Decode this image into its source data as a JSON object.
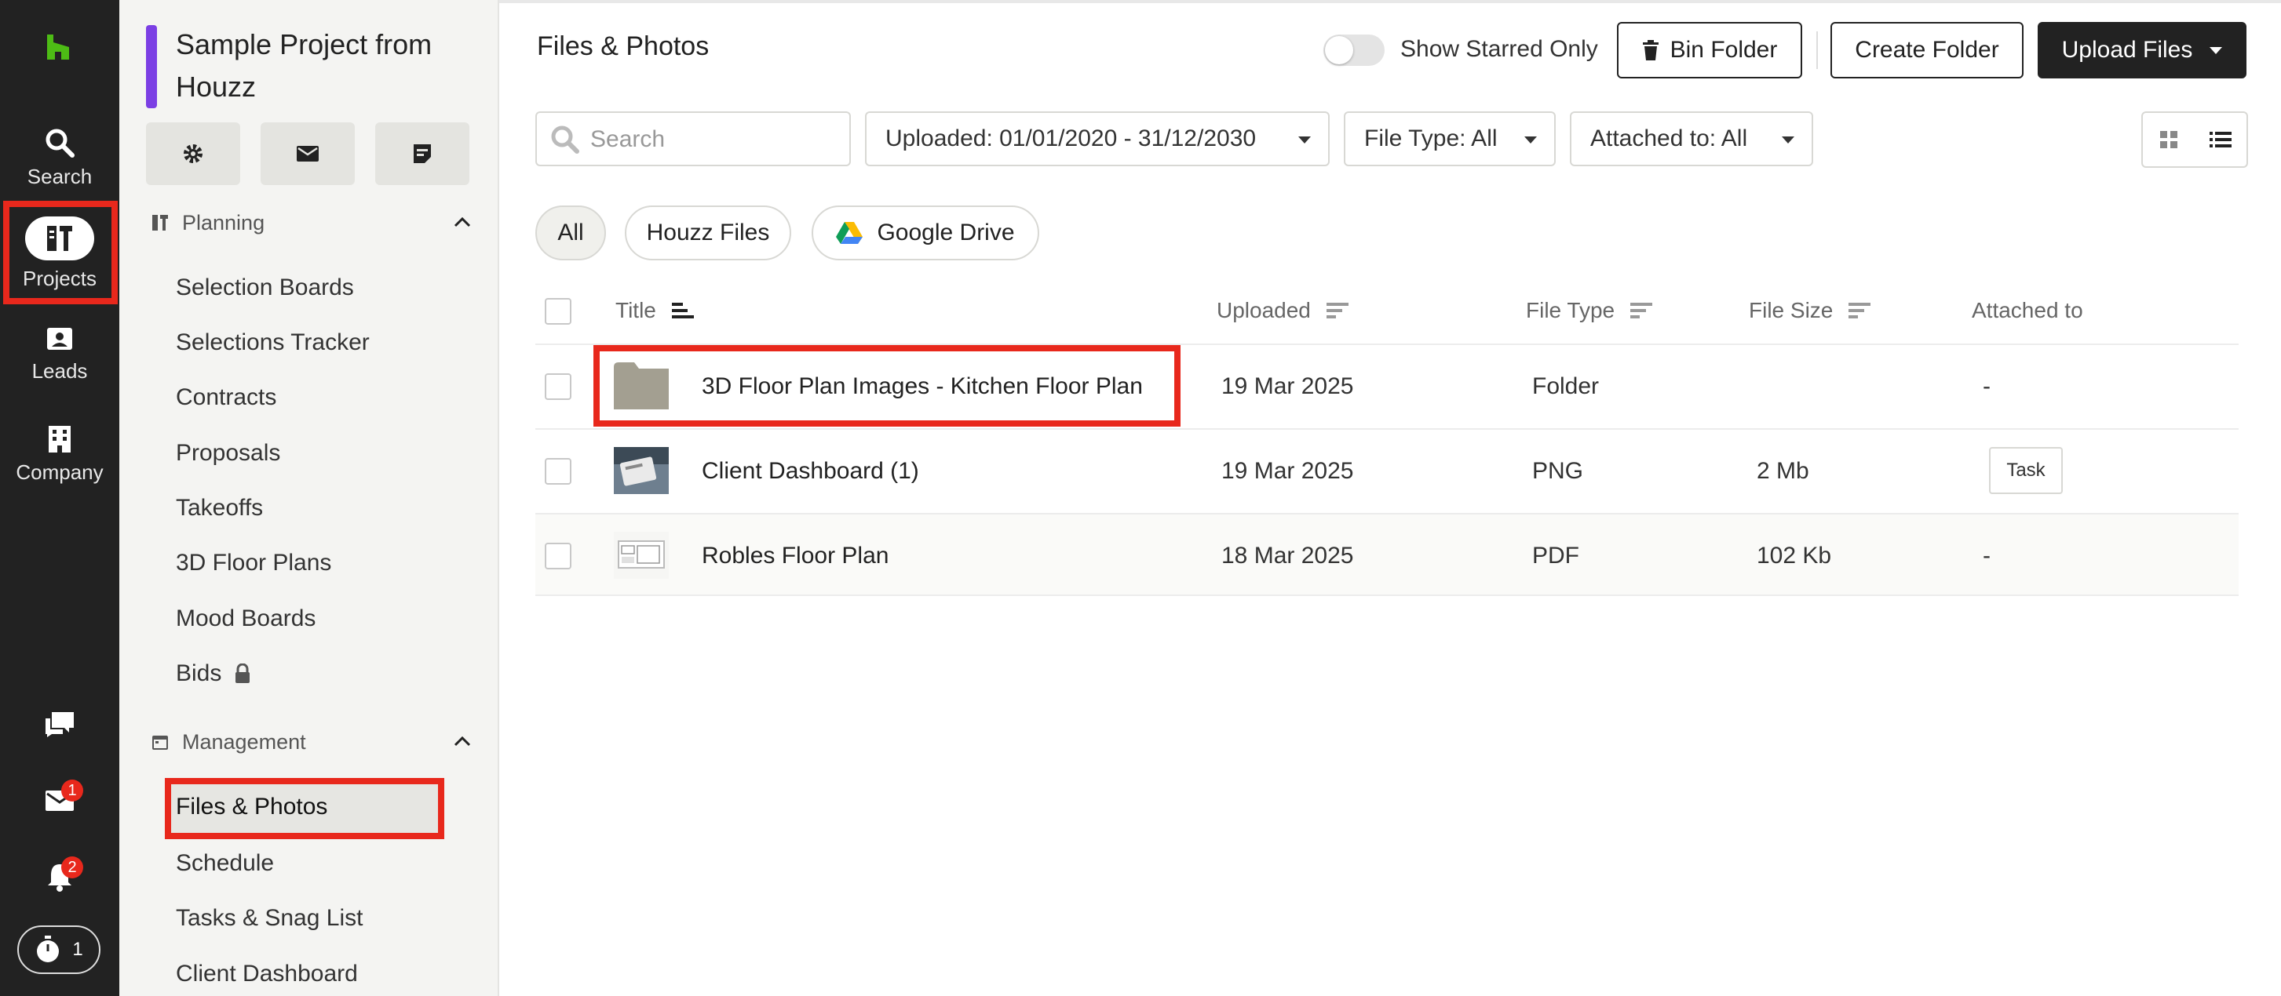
{
  "rail": {
    "items": [
      {
        "label": "Search",
        "icon": "search-icon"
      },
      {
        "label": "Projects",
        "icon": "projects-icon"
      },
      {
        "label": "Leads",
        "icon": "leads-icon"
      },
      {
        "label": "Company",
        "icon": "company-icon"
      }
    ],
    "inbox_badge": "1",
    "notifications_badge": "2",
    "timer_count": "1"
  },
  "sidebar": {
    "project_title": "Sample Project from Houzz",
    "planning": {
      "label": "Planning",
      "items": [
        "Selection Boards",
        "Selections Tracker",
        "Contracts",
        "Proposals",
        "Takeoffs",
        "3D Floor Plans",
        "Mood Boards",
        "Bids"
      ]
    },
    "management": {
      "label": "Management",
      "items": [
        "Files & Photos",
        "Schedule",
        "Tasks & Snag List",
        "Client Dashboard"
      ]
    }
  },
  "header": {
    "title": "Files & Photos",
    "starred_toggle_label": "Show Starred Only",
    "bin_label": "Bin Folder",
    "create_label": "Create Folder",
    "upload_label": "Upload Files"
  },
  "filters": {
    "search_placeholder": "Search",
    "uploaded": "Uploaded: 01/01/2020 - 31/12/2030",
    "file_type": "File Type: All",
    "attached_to": "Attached to: All"
  },
  "sources": {
    "all": "All",
    "houzz": "Houzz Files",
    "drive": "Google Drive"
  },
  "table": {
    "columns": {
      "title": "Title",
      "uploaded": "Uploaded",
      "file_type": "File Type",
      "file_size": "File Size",
      "attached_to": "Attached to"
    },
    "rows": [
      {
        "title": "3D Floor Plan Images - Kitchen Floor Plan",
        "uploaded": "19 Mar 2025",
        "type": "Folder",
        "size": "",
        "attached": "-"
      },
      {
        "title": "Client Dashboard (1)",
        "uploaded": "19 Mar 2025",
        "type": "PNG",
        "size": "2 Mb",
        "attached": "Task"
      },
      {
        "title": "Robles Floor Plan",
        "uploaded": "18 Mar 2025",
        "type": "PDF",
        "size": "102 Kb",
        "attached": "-"
      }
    ]
  },
  "colors": {
    "brand_green": "#4dbc15",
    "project_accent": "#7b3fe4",
    "highlight_red": "#e8281c",
    "rail_bg": "#222222"
  }
}
